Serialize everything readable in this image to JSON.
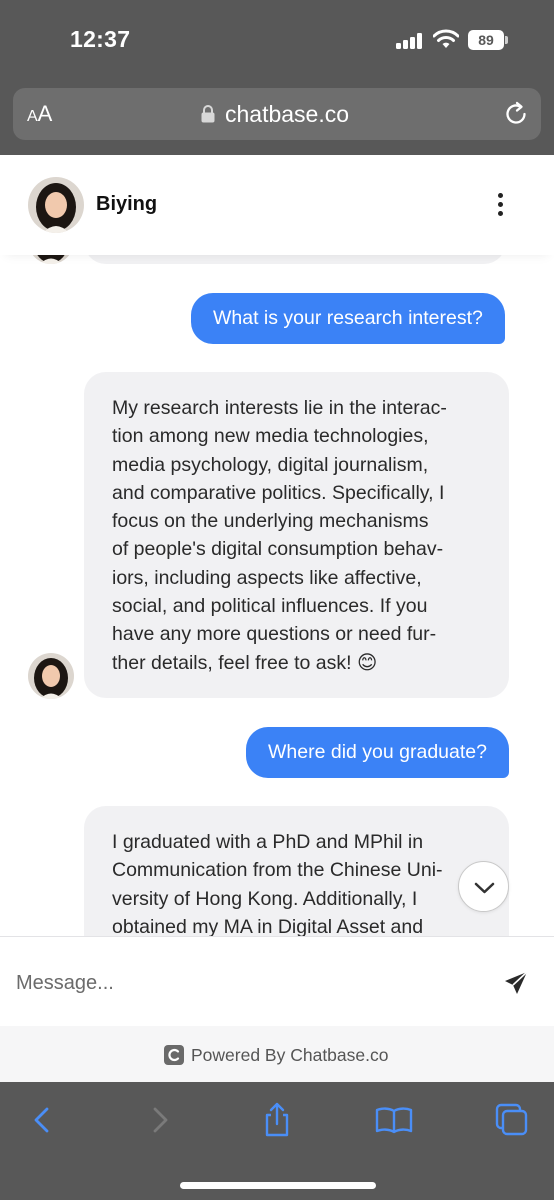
{
  "status_bar": {
    "time": "12:37",
    "battery": "89"
  },
  "browser": {
    "text_size_label_small": "A",
    "text_size_label_large": "A",
    "domain": "chatbase.co"
  },
  "chat": {
    "agent_name": "Biying",
    "messages": [
      {
        "role": "user",
        "text": "What is your research interest?"
      },
      {
        "role": "bot",
        "lines": [
          "My research interests lie in the interac-",
          "tion among new media technologies,",
          "media psychology, digital journalism,",
          "and comparative politics. Specifically, I",
          "focus on the underlying mechanisms",
          "of people's digital consumption behav-",
          "iors, including aspects like affective,",
          "social, and political influences. If you",
          "have any more questions or need fur-",
          "ther details, feel free to ask! 😊"
        ]
      },
      {
        "role": "user",
        "text": "Where did you graduate?"
      },
      {
        "role": "bot",
        "lines": [
          "I graduated with a PhD and MPhil in",
          "Communication from the Chinese Uni-",
          "versity of Hong Kong. Additionally, I",
          "obtained my MA in Digital Asset and"
        ]
      }
    ]
  },
  "composer": {
    "placeholder": "Message..."
  },
  "footer": {
    "powered_by": "Powered By Chatbase.co"
  },
  "colors": {
    "user_bubble": "#3b82f6",
    "bot_bubble": "#f1f1f3",
    "safari_chrome": "#585858",
    "toolbar_icon": "#4a8ef7"
  },
  "icons": [
    "lock-icon",
    "reload-icon",
    "kebab-menu-icon",
    "chevron-down-icon",
    "send-icon",
    "back-icon",
    "forward-icon",
    "share-icon",
    "bookmarks-icon",
    "tabs-icon"
  ]
}
